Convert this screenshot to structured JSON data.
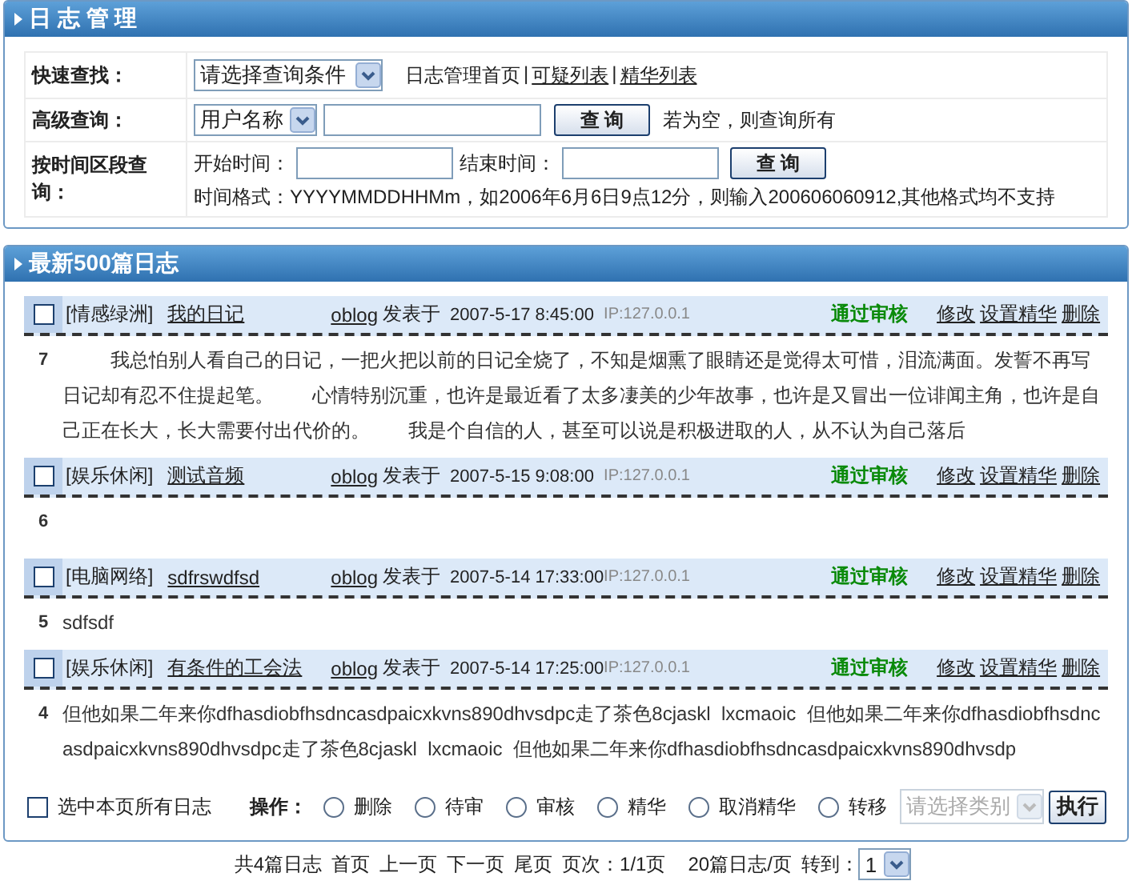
{
  "manage_panel": {
    "title": "日 志 管 理",
    "quick_search": {
      "label": "快速查找：",
      "select": "请选择查询条件",
      "separator": "|",
      "links": [
        {
          "label": "日志管理首页",
          "kind": "plain"
        },
        {
          "label": "可疑列表",
          "kind": "link"
        },
        {
          "label": "精华列表",
          "kind": "link"
        }
      ]
    },
    "advanced_search": {
      "label": "高级查询：",
      "select": "用户名称",
      "button": "查 询",
      "hint": "若为空，则查询所有"
    },
    "time_search": {
      "label": "按时间区段查询：",
      "start_label": "开始时间：",
      "end_label": "结束时间：",
      "button": "查 询",
      "format_note": "时间格式：YYYYMMDDHHMm，如2006年6月6日9点12分，则输入200606060912,其他格式均不支持"
    }
  },
  "logs_panel": {
    "title": "最新500篇日志",
    "entries": [
      {
        "checked": false,
        "category": "[情感绿洲]",
        "title": "我的日记",
        "author": "oblog",
        "posted_label": "发表于",
        "time": "2007-5-17 8:45:00",
        "ip": "IP:127.0.0.1",
        "status": "通过审核",
        "actions": [
          "修改",
          "设置精华",
          "删除"
        ],
        "number": "7",
        "body": "我总怕别人看自己的日记，一把火把以前的日记全烧了，不知是烟熏了眼睛还是觉得太可惜，泪流满面。发誓不再写日记却有忍不住提起笔。　　心情特别沉重，也许是最近看了太多凄美的少年故事，也许是又冒出一位诽闻主角，也许是自己正在长大，长大需要付出代价的。　　我是个自信的人，甚至可以说是积极进取的人，从不认为自己落后"
      },
      {
        "checked": false,
        "category": "[娱乐休闲]",
        "title": "测试音频",
        "author": "oblog",
        "posted_label": "发表于",
        "time": "2007-5-15 9:08:00",
        "ip": "IP:127.0.0.1",
        "status": "通过审核",
        "actions": [
          "修改",
          "设置精华",
          "删除"
        ],
        "number": "6"
      },
      {
        "checked": false,
        "category": "[电脑网络]",
        "title": "sdfrswdfsd",
        "author": "oblog",
        "posted_label": "发表于",
        "time": "2007-5-14 17:33:00",
        "ip": "IP:127.0.0.1",
        "status": "通过审核",
        "actions": [
          "修改",
          "设置精华",
          "删除"
        ],
        "number": "5",
        "body": "sdfsdf"
      },
      {
        "checked": false,
        "category": "[娱乐休闲]",
        "title": "有条件的工会法",
        "author": "oblog",
        "posted_label": "发表于",
        "time": "2007-5-14 17:25:00",
        "ip": "IP:127.0.0.1",
        "status": "通过审核",
        "actions": [
          "修改",
          "设置精华",
          "删除"
        ],
        "number": "4",
        "body": "但他如果二年来你dfhasdiobfhsdncasdpaicxkvns890dhvsdpc走了茶色8cjaskl  lxcmaoic  但他如果二年来你dfhasdiobfhsdncasdpaicxkvns890dhvsdpc走了茶色8cjaskl  lxcmaoic  但他如果二年来你dfhasdiobfhsdncasdpaicxkvns890dhvsdp"
      }
    ],
    "bulk": {
      "select_all": {
        "label": "选中本页所有日志",
        "checked": false
      },
      "operation_label": "操作：",
      "operations": [
        {
          "label": "删除",
          "selected": false
        },
        {
          "label": "待审",
          "selected": false
        },
        {
          "label": "审核",
          "selected": false
        },
        {
          "label": "精华",
          "selected": false
        },
        {
          "label": "取消精华",
          "selected": false
        },
        {
          "label": "转移",
          "selected": false
        }
      ],
      "category_select": {
        "value": "请选择类别",
        "disabled": true
      },
      "execute_button": "执行"
    }
  },
  "pager": {
    "total": "共4篇日志",
    "links": [
      "首页",
      "上一页",
      "下一页",
      "尾页"
    ],
    "page_info": "页次：1/1页",
    "per_page": "20篇日志/页",
    "goto_label": "转到：",
    "goto_select": "1"
  }
}
